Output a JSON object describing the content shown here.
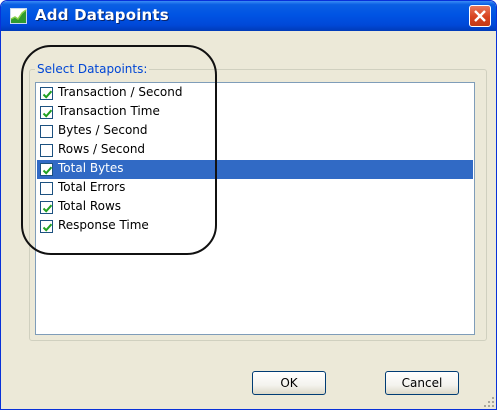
{
  "window": {
    "title": "Add Datapoints",
    "icon": "chart-icon",
    "close_icon": "close-icon"
  },
  "group": {
    "label": "Select Datapoints:"
  },
  "datapoints": [
    {
      "label": "Transaction / Second",
      "checked": true,
      "selected": false
    },
    {
      "label": "Transaction Time",
      "checked": true,
      "selected": false
    },
    {
      "label": "Bytes / Second",
      "checked": false,
      "selected": false
    },
    {
      "label": "Rows / Second",
      "checked": false,
      "selected": false
    },
    {
      "label": "Total Bytes",
      "checked": true,
      "selected": true
    },
    {
      "label": "Total Errors",
      "checked": false,
      "selected": false
    },
    {
      "label": "Total Rows",
      "checked": true,
      "selected": false
    },
    {
      "label": "Response Time",
      "checked": true,
      "selected": false
    }
  ],
  "buttons": {
    "ok": "OK",
    "cancel": "Cancel"
  },
  "colors": {
    "titlebar": "#0054e3",
    "selection": "#316ac5",
    "checkmark": "#21a121",
    "group_label": "#0046d5",
    "annotation": "#111111"
  }
}
